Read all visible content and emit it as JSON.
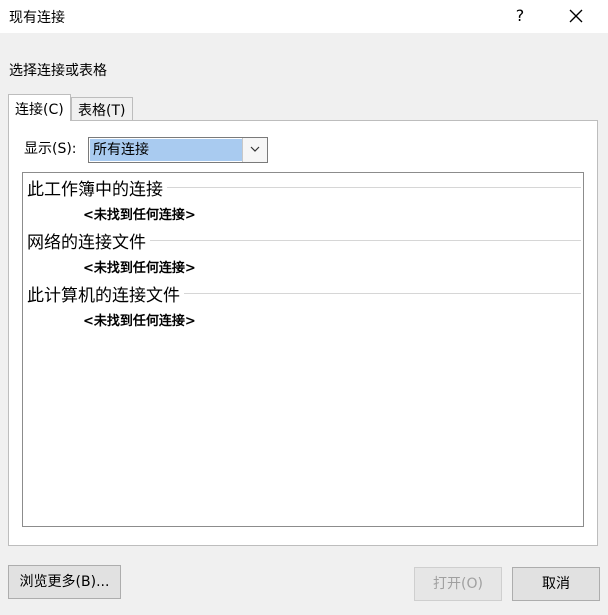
{
  "window": {
    "title": "现有连接",
    "help_label": "?"
  },
  "prompt": "选择连接或表格",
  "tabs": [
    {
      "label": "连接(C)",
      "selected": true
    },
    {
      "label": "表格(T)",
      "selected": false
    }
  ],
  "show_filter": {
    "label": "显示(S):",
    "selected_value": "所有连接"
  },
  "groups": [
    {
      "header": "此工作簿中的连接",
      "empty_text": "<未找到任何连接>"
    },
    {
      "header": "网络的连接文件",
      "empty_text": "<未找到任何连接>"
    },
    {
      "header": "此计算机的连接文件",
      "empty_text": "<未找到任何连接>"
    }
  ],
  "buttons": {
    "browse_label": "浏览更多(B)...",
    "open_label": "打开(O)",
    "cancel_label": "取消"
  },
  "colors": {
    "selection_highlight": "#a9cbf0",
    "dialog_background": "#f0f0f0"
  }
}
